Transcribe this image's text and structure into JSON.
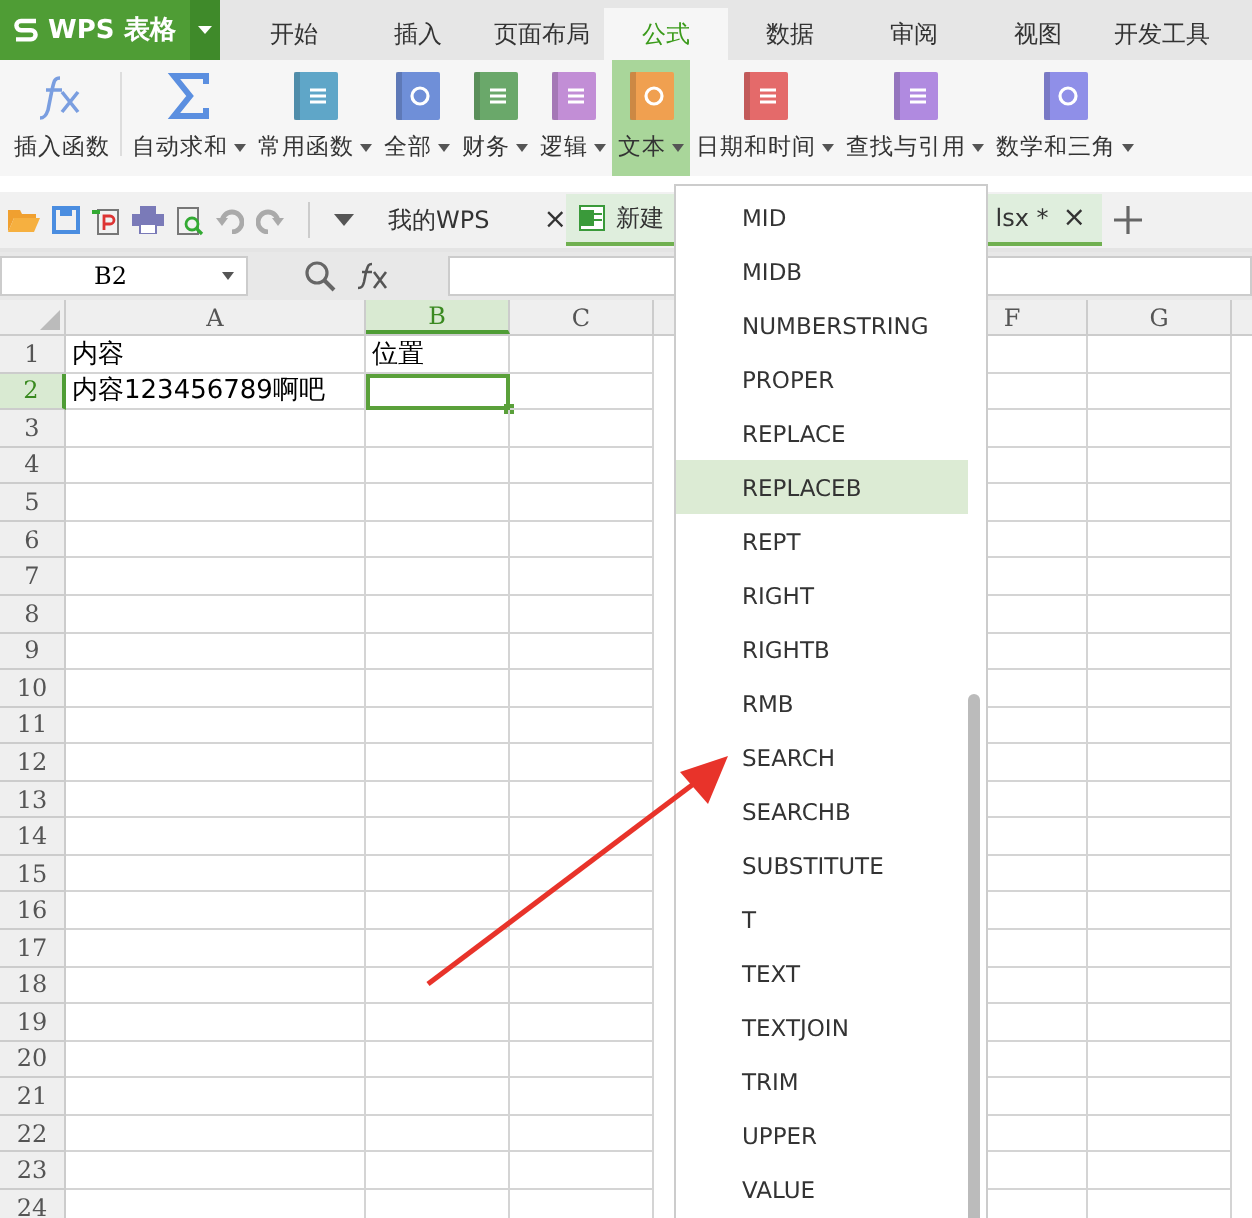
{
  "app": {
    "logo": "WPS 表格"
  },
  "tabs": [
    {
      "label": "开始",
      "selected": false
    },
    {
      "label": "插入",
      "selected": false
    },
    {
      "label": "页面布局",
      "selected": false
    },
    {
      "label": "公式",
      "selected": true
    },
    {
      "label": "数据",
      "selected": false
    },
    {
      "label": "审阅",
      "selected": false
    },
    {
      "label": "视图",
      "selected": false
    },
    {
      "label": "开发工具",
      "selected": false
    }
  ],
  "ribbon": [
    {
      "label": "插入函数",
      "dropdown": false,
      "selected": false
    },
    {
      "label": "自动求和",
      "dropdown": true,
      "selected": false
    },
    {
      "label": "常用函数",
      "dropdown": true,
      "selected": false
    },
    {
      "label": "全部",
      "dropdown": true,
      "selected": false
    },
    {
      "label": "财务",
      "dropdown": true,
      "selected": false
    },
    {
      "label": "逻辑",
      "dropdown": true,
      "selected": false
    },
    {
      "label": "文本",
      "dropdown": true,
      "selected": true
    },
    {
      "label": "日期和时间",
      "dropdown": true,
      "selected": false
    },
    {
      "label": "查找与引用",
      "dropdown": true,
      "selected": false
    },
    {
      "label": "数学和三角",
      "dropdown": true,
      "selected": false
    }
  ],
  "doc_tabs": [
    {
      "label": "我的WPS",
      "kind": "home",
      "selected": false,
      "close": "×"
    },
    {
      "label": "新建",
      "label_end": "lsx *",
      "kind": "sheet",
      "selected": true,
      "close": "×"
    }
  ],
  "formula_bar": {
    "cell": "B2"
  },
  "sheet": {
    "columns": [
      {
        "label": "A",
        "selected": false
      },
      {
        "label": "B",
        "selected": true
      },
      {
        "label": "C",
        "selected": false
      },
      {
        "label": "F",
        "selected": false
      },
      {
        "label": "G",
        "selected": false
      }
    ],
    "rows": [
      {
        "label": "1",
        "selected": false,
        "cells": [
          "内容",
          "位置"
        ]
      },
      {
        "label": "2",
        "selected": true,
        "cells": [
          "内容123456789啊吧"
        ]
      },
      {
        "label": "3",
        "selected": false
      },
      {
        "label": "4",
        "selected": false
      },
      {
        "label": "5",
        "selected": false
      },
      {
        "label": "6",
        "selected": false
      },
      {
        "label": "7",
        "selected": false
      },
      {
        "label": "8",
        "selected": false
      },
      {
        "label": "9",
        "selected": false
      },
      {
        "label": "10",
        "selected": false
      },
      {
        "label": "11",
        "selected": false
      },
      {
        "label": "12",
        "selected": false
      },
      {
        "label": "13",
        "selected": false
      },
      {
        "label": "14",
        "selected": false
      },
      {
        "label": "15",
        "selected": false
      },
      {
        "label": "16",
        "selected": false
      },
      {
        "label": "17",
        "selected": false
      },
      {
        "label": "18",
        "selected": false
      },
      {
        "label": "19",
        "selected": false
      },
      {
        "label": "20",
        "selected": false
      },
      {
        "label": "21",
        "selected": false
      },
      {
        "label": "22",
        "selected": false
      },
      {
        "label": "23",
        "selected": false
      },
      {
        "label": "24",
        "selected": false
      }
    ]
  },
  "text_menu": [
    {
      "label": "MID",
      "selected": false
    },
    {
      "label": "MIDB",
      "selected": false
    },
    {
      "label": "NUMBERSTRING",
      "selected": false
    },
    {
      "label": "PROPER",
      "selected": false
    },
    {
      "label": "REPLACE",
      "selected": false
    },
    {
      "label": "REPLACEB",
      "selected": true
    },
    {
      "label": "REPT",
      "selected": false
    },
    {
      "label": "RIGHT",
      "selected": false
    },
    {
      "label": "RIGHTB",
      "selected": false
    },
    {
      "label": "RMB",
      "selected": false
    },
    {
      "label": "SEARCH",
      "selected": false
    },
    {
      "label": "SEARCHB",
      "selected": false
    },
    {
      "label": "SUBSTITUTE",
      "selected": false
    },
    {
      "label": "T",
      "selected": false
    },
    {
      "label": "TEXT",
      "selected": false
    },
    {
      "label": "TEXTJOIN",
      "selected": false
    },
    {
      "label": "TRIM",
      "selected": false
    },
    {
      "label": "UPPER",
      "selected": false
    },
    {
      "label": "VALUE",
      "selected": false
    }
  ]
}
